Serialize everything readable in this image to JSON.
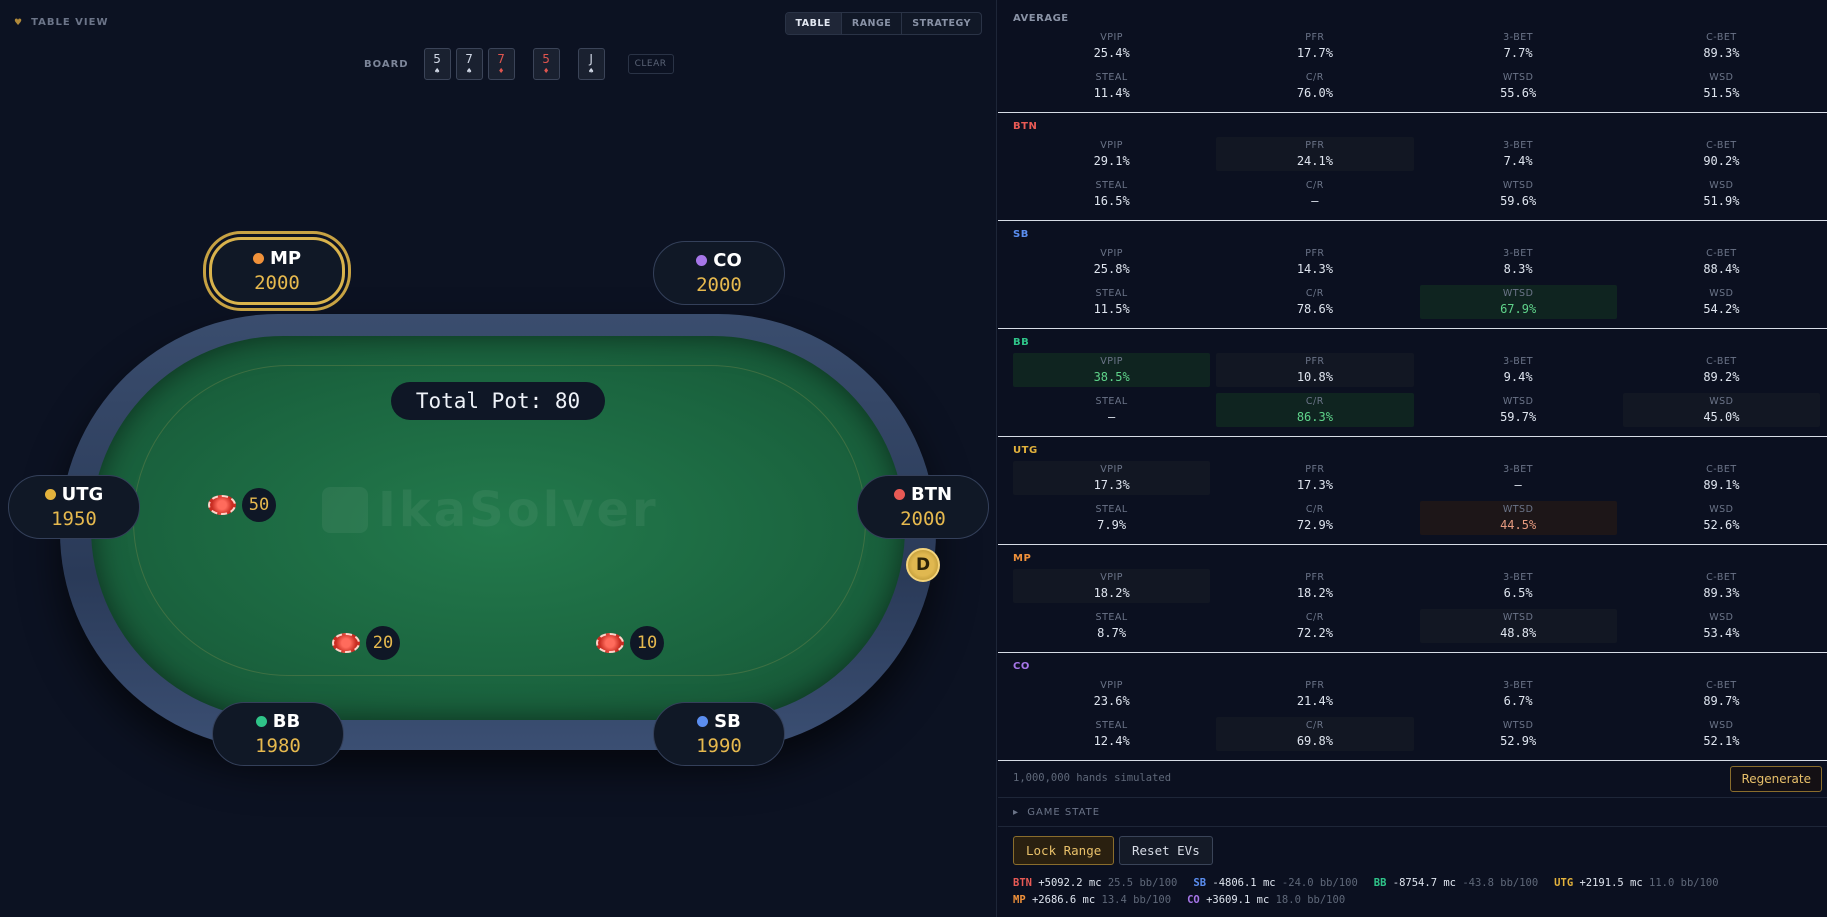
{
  "left": {
    "label": "TABLE VIEW",
    "tabs": [
      {
        "label": "TABLE",
        "active": true
      },
      {
        "label": "RANGE",
        "active": false
      },
      {
        "label": "STRATEGY",
        "active": false
      }
    ],
    "board": {
      "label": "BOARD",
      "cards": [
        {
          "rank": "5",
          "suit": "♠",
          "red": false
        },
        {
          "rank": "7",
          "suit": "♠",
          "red": false
        },
        {
          "rank": "7",
          "suit": "♦",
          "red": true
        },
        {
          "rank": "5",
          "suit": "♦",
          "red": true
        },
        {
          "rank": "J",
          "suit": "♠",
          "red": false
        }
      ],
      "clear_label": "CLEAR"
    },
    "pot_label": "Total Pot: 80",
    "watermark": "IkaSolver",
    "seats": {
      "mp": {
        "name": "MP",
        "stack": "2000",
        "color": "#f0913a"
      },
      "co": {
        "name": "CO",
        "stack": "2000",
        "color": "#a676e8"
      },
      "utg": {
        "name": "UTG",
        "stack": "1950",
        "color": "#e3b23c"
      },
      "btn": {
        "name": "BTN",
        "stack": "2000",
        "color": "#e85a55"
      },
      "bb": {
        "name": "BB",
        "stack": "1980",
        "color": "#2fc489"
      },
      "sb": {
        "name": "SB",
        "stack": "1990",
        "color": "#5b8ef0"
      }
    },
    "bets": {
      "utg": "50",
      "bb": "20",
      "sb": "10"
    },
    "dealer_label": "D"
  },
  "right": {
    "blocks": [
      {
        "title": "AVERAGE",
        "color": "#8a93a6",
        "cells": [
          {
            "k": "VPIP",
            "v": "25.4%",
            "s": ""
          },
          {
            "k": "PFR",
            "v": "17.7%",
            "s": ""
          },
          {
            "k": "3-BET",
            "v": "7.7%",
            "s": ""
          },
          {
            "k": "C-BET",
            "v": "89.3%",
            "s": ""
          },
          {
            "k": "STEAL",
            "v": "11.4%",
            "s": ""
          },
          {
            "k": "C/R",
            "v": "76.0%",
            "s": ""
          },
          {
            "k": "WTSD",
            "v": "55.6%",
            "s": ""
          },
          {
            "k": "WSD",
            "v": "51.5%",
            "s": ""
          }
        ]
      },
      {
        "title": "BTN",
        "color": "#e85a55",
        "cells": [
          {
            "k": "VPIP",
            "v": "29.1%",
            "s": ""
          },
          {
            "k": "PFR",
            "v": "24.1%",
            "s": "d"
          },
          {
            "k": "3-BET",
            "v": "7.4%",
            "s": ""
          },
          {
            "k": "C-BET",
            "v": "90.2%",
            "s": ""
          },
          {
            "k": "STEAL",
            "v": "16.5%",
            "s": ""
          },
          {
            "k": "C/R",
            "v": "—",
            "s": ""
          },
          {
            "k": "WTSD",
            "v": "59.6%",
            "s": ""
          },
          {
            "k": "WSD",
            "v": "51.9%",
            "s": ""
          }
        ]
      },
      {
        "title": "SB",
        "color": "#5b8ef0",
        "cells": [
          {
            "k": "VPIP",
            "v": "25.8%",
            "s": ""
          },
          {
            "k": "PFR",
            "v": "14.3%",
            "s": ""
          },
          {
            "k": "3-BET",
            "v": "8.3%",
            "s": ""
          },
          {
            "k": "C-BET",
            "v": "88.4%",
            "s": ""
          },
          {
            "k": "STEAL",
            "v": "11.5%",
            "s": ""
          },
          {
            "k": "C/R",
            "v": "78.6%",
            "s": ""
          },
          {
            "k": "WTSD",
            "v": "67.9%",
            "s": "g"
          },
          {
            "k": "WSD",
            "v": "54.2%",
            "s": ""
          }
        ]
      },
      {
        "title": "BB",
        "color": "#2fc489",
        "cells": [
          {
            "k": "VPIP",
            "v": "38.5%",
            "s": "g"
          },
          {
            "k": "PFR",
            "v": "10.8%",
            "s": "d"
          },
          {
            "k": "3-BET",
            "v": "9.4%",
            "s": ""
          },
          {
            "k": "C-BET",
            "v": "89.2%",
            "s": ""
          },
          {
            "k": "STEAL",
            "v": "—",
            "s": ""
          },
          {
            "k": "C/R",
            "v": "86.3%",
            "s": "g"
          },
          {
            "k": "WTSD",
            "v": "59.7%",
            "s": ""
          },
          {
            "k": "WSD",
            "v": "45.0%",
            "s": "d"
          }
        ]
      },
      {
        "title": "UTG",
        "color": "#e3b23c",
        "cells": [
          {
            "k": "VPIP",
            "v": "17.3%",
            "s": "d"
          },
          {
            "k": "PFR",
            "v": "17.3%",
            "s": ""
          },
          {
            "k": "3-BET",
            "v": "—",
            "s": ""
          },
          {
            "k": "C-BET",
            "v": "89.1%",
            "s": ""
          },
          {
            "k": "STEAL",
            "v": "7.9%",
            "s": ""
          },
          {
            "k": "C/R",
            "v": "72.9%",
            "s": ""
          },
          {
            "k": "WTSD",
            "v": "44.5%",
            "s": "rr"
          },
          {
            "k": "WSD",
            "v": "52.6%",
            "s": ""
          }
        ]
      },
      {
        "title": "MP",
        "color": "#f0913a",
        "cells": [
          {
            "k": "VPIP",
            "v": "18.2%",
            "s": "d"
          },
          {
            "k": "PFR",
            "v": "18.2%",
            "s": ""
          },
          {
            "k": "3-BET",
            "v": "6.5%",
            "s": ""
          },
          {
            "k": "C-BET",
            "v": "89.3%",
            "s": ""
          },
          {
            "k": "STEAL",
            "v": "8.7%",
            "s": ""
          },
          {
            "k": "C/R",
            "v": "72.2%",
            "s": ""
          },
          {
            "k": "WTSD",
            "v": "48.8%",
            "s": "d"
          },
          {
            "k": "WSD",
            "v": "53.4%",
            "s": ""
          }
        ]
      },
      {
        "title": "CO",
        "color": "#a676e8",
        "cells": [
          {
            "k": "VPIP",
            "v": "23.6%",
            "s": ""
          },
          {
            "k": "PFR",
            "v": "21.4%",
            "s": ""
          },
          {
            "k": "3-BET",
            "v": "6.7%",
            "s": ""
          },
          {
            "k": "C-BET",
            "v": "89.7%",
            "s": ""
          },
          {
            "k": "STEAL",
            "v": "12.4%",
            "s": ""
          },
          {
            "k": "C/R",
            "v": "69.8%",
            "s": "d"
          },
          {
            "k": "WTSD",
            "v": "52.9%",
            "s": ""
          },
          {
            "k": "WSD",
            "v": "52.1%",
            "s": ""
          }
        ]
      }
    ],
    "sim_text": "1,000,000 hands simulated",
    "regenerate_label": "Regenerate",
    "game_state_label": "GAME STATE",
    "lock_range_label": "Lock Range",
    "reset_evs_label": "Reset EVs",
    "evs": [
      [
        {
          "pos": "BTN",
          "color": "#e85a55",
          "val": "+5092.2 mc",
          "bb": "25.5 bb/100"
        },
        {
          "pos": "SB",
          "color": "#5b8ef0",
          "val": "-4806.1 mc",
          "bb": "-24.0 bb/100"
        },
        {
          "pos": "BB",
          "color": "#2fc489",
          "val": "-8754.7 mc",
          "bb": "-43.8 bb/100"
        },
        {
          "pos": "UTG",
          "color": "#e3b23c",
          "val": "+2191.5 mc",
          "bb": "11.0 bb/100"
        }
      ],
      [
        {
          "pos": "MP",
          "color": "#f0913a",
          "val": "+2686.6 mc",
          "bb": "13.4 bb/100"
        },
        {
          "pos": "CO",
          "color": "#a676e8",
          "val": "+3609.1 mc",
          "bb": "18.0 bb/100"
        }
      ]
    ]
  }
}
